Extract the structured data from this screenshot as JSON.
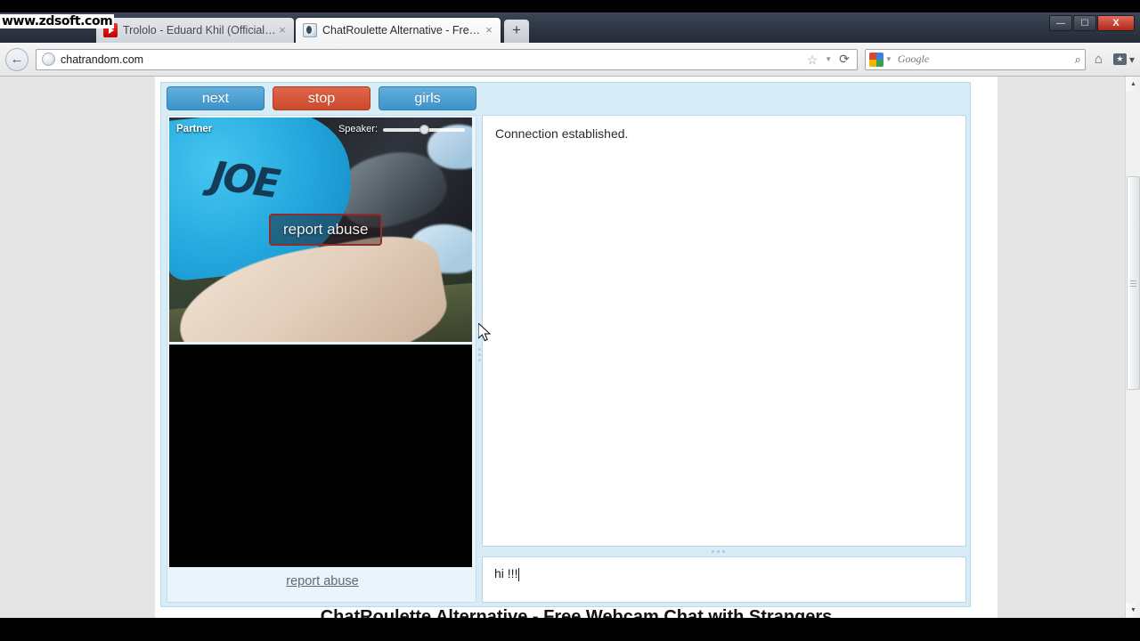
{
  "watermark": {
    "text": "www.zdsoft.com"
  },
  "window": {
    "minimize_label": "—",
    "restore_label": "❐",
    "close_label": "X"
  },
  "tabs": [
    {
      "title": "Trololo - Eduard Khil (Official Video) ...",
      "favicon": "youtube-icon",
      "close_label": "×",
      "active": false
    },
    {
      "title": "ChatRoulette Alternative - Free Webc...",
      "favicon": "globe-icon",
      "close_label": "×",
      "active": true
    }
  ],
  "newtab_label": "+",
  "navbar": {
    "back_label": "←",
    "address_value": "chatrandom.com",
    "star_label": "☆",
    "caret_label": "▼",
    "reload_label": "⟳",
    "home_label": "⌂",
    "favorites_label": "★",
    "favorites_caret": "▾"
  },
  "search": {
    "engine": "google-icon",
    "placeholder": "Google",
    "magnifier_label": "⌕"
  },
  "site": {
    "controls": [
      {
        "label": "next",
        "style": "blue"
      },
      {
        "label": "stop",
        "style": "red"
      },
      {
        "label": "girls",
        "style": "blue"
      }
    ],
    "partner_video": {
      "label": "Partner",
      "speaker_label": "Speaker:",
      "volume_percent": 45,
      "report_overlay_label": "report abuse",
      "shirt_text": "JOE"
    },
    "self_video": {
      "label": ""
    },
    "report_link_label": "report abuse",
    "chat": {
      "log_message": "Connection established.",
      "input_value": "hi !!!"
    },
    "page_heading": "ChatRoulette Alternative - Free Webcam Chat with Strangers"
  },
  "colors": {
    "button_blue": "#3d93c9",
    "button_red": "#cc4a2c",
    "panel_blue": "#d8ecf7",
    "chat_border": "#b9d4e6"
  }
}
